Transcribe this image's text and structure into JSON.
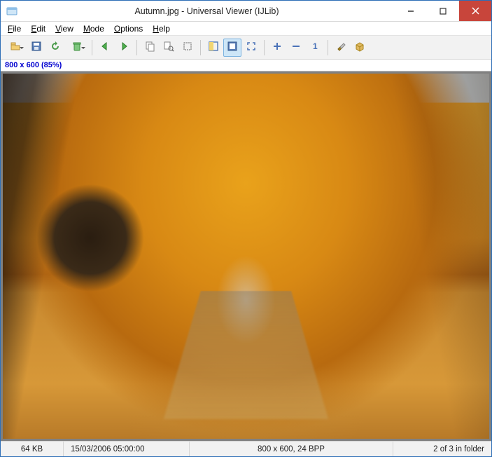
{
  "window": {
    "title": "Autumn.jpg - Universal Viewer (IJLib)"
  },
  "menu": {
    "file": "File",
    "edit": "Edit",
    "view": "View",
    "mode": "Mode",
    "options": "Options",
    "help": "Help"
  },
  "toolbar": {
    "open": "open-icon",
    "save": "save-icon",
    "reload": "reload-icon",
    "delete": "delete-icon",
    "prev": "prev-icon",
    "next": "next-icon",
    "copy": "copy-icon",
    "zoom": "zoom-icon",
    "select": "select-icon",
    "fit_window": "fit-window-icon",
    "fit_image": "fit-image-icon",
    "fullscreen": "fullscreen-icon",
    "zoom_in": "plus-icon",
    "zoom_out": "minus-icon",
    "actual": "one-icon",
    "tools": "tools-icon",
    "plugins": "box-icon"
  },
  "info_overlay": "800 x 600 (85%)",
  "image": {
    "description": "Photograph: tree-lined path covered in orange autumn leaves, large dark tree trunk on left, wooden fence on right, overcast sky visible through canopy."
  },
  "status": {
    "filesize": "64 KB",
    "datetime": "15/03/2006 05:00:00",
    "dimensions": "800 x 600, 24 BPP",
    "position": "2 of 3 in folder"
  }
}
